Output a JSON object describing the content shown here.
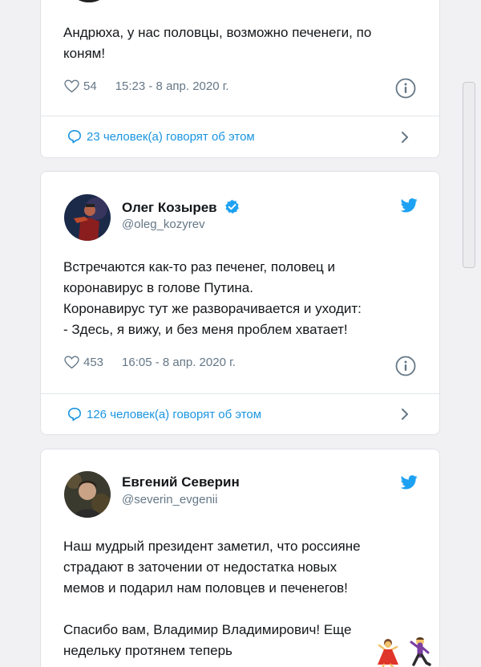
{
  "tweets": [
    {
      "text_lines": [
        "Андрюха, у нас половцы, возможно печенеги, по",
        "коням!"
      ],
      "likes": "54",
      "timestamp": "15:23 - 8 апр. 2020 г.",
      "conversation": "23 человек(а) говорят об этом"
    },
    {
      "author_name": "Олег Козырев",
      "handle": "@oleg_kozyrev",
      "verified": true,
      "text_lines": [
        "Встречаются как-то раз печенег, половец и",
        "коронавирус в голове Путина.",
        "Коронавирус тут же разворачивается и уходит:",
        "- Здесь, я вижу, и без меня проблем хватает!"
      ],
      "likes": "453",
      "timestamp": "16:05 - 8 апр. 2020 г.",
      "conversation": "126 человек(а) говорят об этом"
    },
    {
      "author_name": "Евгений Северин",
      "handle": "@severin_evgenii",
      "verified": false,
      "text_lines": [
        "Наш мудрый президент заметил, что россияне",
        "страдают в заточении от недостатка новых",
        "мемов и подарил нам половцев и печенегов!",
        "",
        "Спасибо вам, Владимир Владимирович! Еще",
        "недельку протянем теперь"
      ],
      "emojis": [
        "woman-dancing-emoji",
        "man-dancing-emoji"
      ]
    }
  ],
  "colors": {
    "accent": "#1b95e0",
    "twitter_blue": "#1da1f2",
    "muted": "#657786",
    "text": "#14171a",
    "background": "#f1f1f3"
  }
}
